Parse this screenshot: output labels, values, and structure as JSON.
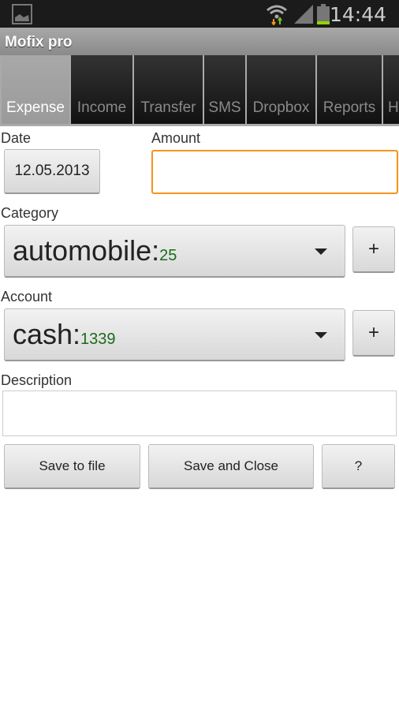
{
  "status": {
    "time": "14:44"
  },
  "app": {
    "title": "Mofix pro"
  },
  "tabs": [
    {
      "label": "Expense"
    },
    {
      "label": "Income"
    },
    {
      "label": "Transfer"
    },
    {
      "label": "SMS"
    },
    {
      "label": "Dropbox"
    },
    {
      "label": "Reports"
    },
    {
      "label": "H"
    }
  ],
  "form": {
    "date_label": "Date",
    "date_value": "12.05.2013",
    "amount_label": "Amount",
    "amount_value": "",
    "category_label": "Category",
    "category_value": "automobile:",
    "category_count": "25",
    "account_label": "Account",
    "account_value": "cash:",
    "account_count": "1339",
    "description_label": "Description",
    "description_value": "",
    "add_label": "+",
    "save_file": "Save to file",
    "save_close": "Save and Close",
    "help": "?"
  },
  "colors": {
    "focus": "#f7931e",
    "count": "#1a6b1a"
  }
}
